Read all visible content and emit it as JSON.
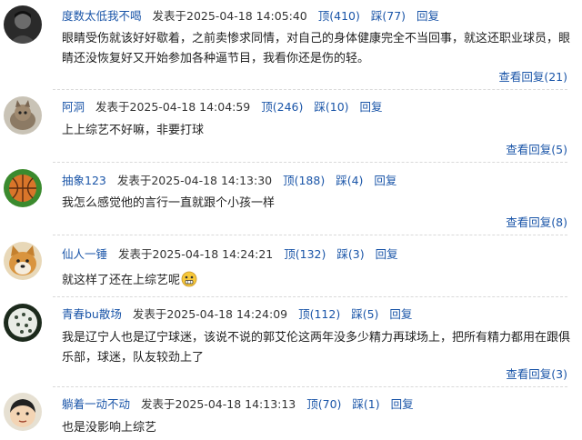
{
  "comments": [
    {
      "user": "度数太低我不喝",
      "time": "发表于2025-04-18 14:05:40",
      "up_label": "顶(410)",
      "down_label": "踩(77)",
      "reply_label": "回复",
      "text": "眼睛受伤就该好好歇着，之前卖惨求同情，对自己的身体健康完全不当回事，就这还职业球员，眼睛还没恢复好又开始参加各种逼节目，我看你还是伤的轻。",
      "view_replies": "查看回复(21)",
      "avatar_icon": "avatar-dark-portrait"
    },
    {
      "user": "阿洞",
      "time": "发表于2025-04-18 14:04:59",
      "up_label": "顶(246)",
      "down_label": "踩(10)",
      "reply_label": "回复",
      "text": "上上综艺不好嘛，非要打球",
      "view_replies": "查看回复(5)",
      "avatar_icon": "avatar-cat"
    },
    {
      "user": "抽象123",
      "time": "发表于2025-04-18 14:13:30",
      "up_label": "顶(188)",
      "down_label": "踩(4)",
      "reply_label": "回复",
      "text": "我怎么感觉他的言行一直就跟个小孩一样",
      "view_replies": "查看回复(8)",
      "avatar_icon": "avatar-basketball"
    },
    {
      "user": "仙人一锤",
      "time": "发表于2025-04-18 14:24:21",
      "up_label": "顶(132)",
      "down_label": "踩(3)",
      "reply_label": "回复",
      "text": "就这样了还在上综艺呢",
      "view_replies": "",
      "avatar_icon": "avatar-shiba-dog"
    },
    {
      "user": "青春bu散场",
      "time": "发表于2025-04-18 14:24:09",
      "up_label": "顶(112)",
      "down_label": "踩(5)",
      "reply_label": "回复",
      "text": "我是辽宁人也是辽宁球迷，该说不说的郭艾伦这两年没多少精力再球场上，把所有精力都用在跟俱乐部，球迷，队友较劲上了",
      "view_replies": "查看回复(3)",
      "avatar_icon": "avatar-dotted-ball"
    },
    {
      "user": "躺着一动不动",
      "time": "发表于2025-04-18 14:13:13",
      "up_label": "顶(70)",
      "down_label": "踩(1)",
      "reply_label": "回复",
      "text": "也是没影响上综艺",
      "view_replies": "",
      "avatar_icon": "avatar-cartoon-boy"
    }
  ],
  "emoji_icon": "grimace-emoji-icon",
  "colors": {
    "link": "#1a55a8",
    "text": "#222222",
    "separator": "#d9d9d9"
  }
}
